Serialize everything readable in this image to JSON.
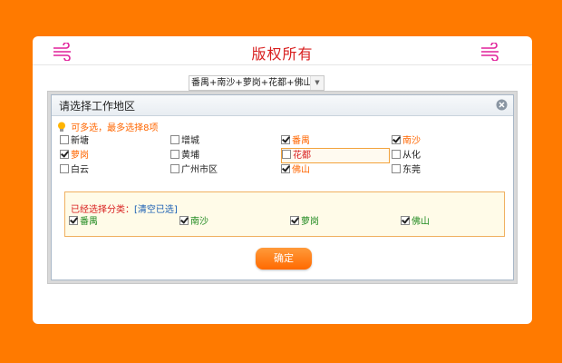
{
  "header": {
    "title": "版权所有"
  },
  "selector": {
    "value": "番禺+南沙+萝岗+花都+佛山"
  },
  "dialog": {
    "title": "请选择工作地区",
    "hint": "可多选，最多选择8项",
    "regions": [
      {
        "label": "新塘",
        "checked": false
      },
      {
        "label": "增城",
        "checked": false
      },
      {
        "label": "番禺",
        "checked": true
      },
      {
        "label": "南沙",
        "checked": true
      },
      {
        "label": "萝岗",
        "checked": true
      },
      {
        "label": "黄埔",
        "checked": false
      },
      {
        "label": "花都",
        "checked": false
      },
      {
        "label": "从化",
        "checked": false
      },
      {
        "label": "白云",
        "checked": false
      },
      {
        "label": "广州市区",
        "checked": false
      },
      {
        "label": "佛山",
        "checked": true
      },
      {
        "label": "东莞",
        "checked": false
      }
    ],
    "chosen_label": "已经选择分类：",
    "clear_label": "[清空已选]",
    "chosen": [
      "番禺",
      "南沙",
      "萝岗",
      "佛山"
    ],
    "confirm_label": "确定"
  },
  "colors": {
    "background": "#ff7a00",
    "accent": "#ff6600",
    "title": "#d81e1e",
    "chosen_text": "#228b22"
  }
}
